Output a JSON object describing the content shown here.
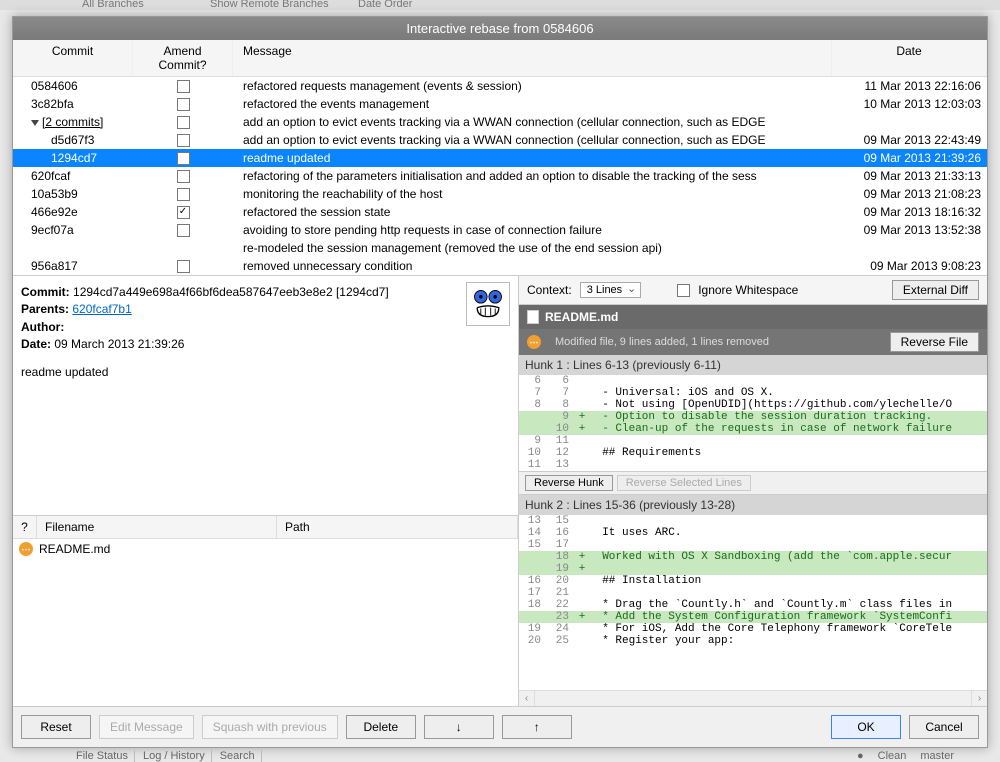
{
  "backdrop": {
    "branches": "All Branches",
    "show_remote": "Show Remote Branches",
    "date_order": "Date Order"
  },
  "dialog": {
    "title": "Interactive rebase from 0584606"
  },
  "columns": {
    "commit": "Commit",
    "amend": "Amend Commit?",
    "message": "Message",
    "date": "Date"
  },
  "rows": [
    {
      "sha": "0584606",
      "indent": false,
      "amend": false,
      "msg": "refactored requests management (events & session)",
      "date": "11 Mar 2013 22:16:06",
      "group": false
    },
    {
      "sha": "3c82bfa",
      "indent": false,
      "amend": false,
      "msg": "refactored the events management",
      "date": "10 Mar 2013 12:03:03",
      "group": false
    },
    {
      "sha": "[2 commits]",
      "indent": false,
      "amend": false,
      "msg": "add an option to evict events tracking via a WWAN connection (cellular connection, such as EDGE",
      "date": "",
      "group": true
    },
    {
      "sha": "d5d67f3",
      "indent": true,
      "amend": false,
      "msg": "add an option to evict events tracking via a WWAN connection (cellular connection, such as EDGE",
      "date": "09 Mar 2013 22:43:49",
      "group": false
    },
    {
      "sha": "1294cd7",
      "indent": true,
      "amend": false,
      "msg": "readme updated",
      "date": "09 Mar 2013 21:39:26",
      "group": false,
      "selected": true
    },
    {
      "sha": "620fcaf",
      "indent": false,
      "amend": false,
      "msg": "refactoring of the parameters initialisation and added an option to disable the tracking of the sess",
      "date": "09 Mar 2013 21:33:13",
      "group": false
    },
    {
      "sha": "10a53b9",
      "indent": false,
      "amend": false,
      "msg": "monitoring the reachability of the host",
      "date": "09 Mar 2013 21:08:23",
      "group": false
    },
    {
      "sha": "466e92e",
      "indent": false,
      "amend": true,
      "msg": "refactored the session state",
      "date": "09 Mar 2013 18:16:32",
      "group": false
    },
    {
      "sha": "9ecf07a",
      "indent": false,
      "amend": false,
      "msg": "avoiding to store pending http requests in case of connection failure",
      "date": "09 Mar 2013 13:52:38",
      "group": false
    },
    {
      "sha": "",
      "indent": false,
      "amend": null,
      "msg": "re-modeled the session management (removed the use of the end session api)",
      "date": "",
      "group": false
    },
    {
      "sha": "956a817",
      "indent": false,
      "amend": false,
      "msg": "removed unnecessary condition",
      "date": "09 Mar 2013 9:08:23",
      "group": false
    }
  ],
  "detail": {
    "commit_label": "Commit:",
    "commit_value": "1294cd7a449e698a4f66bf6dea587647eeb3e8e2 [1294cd7]",
    "parents_label": "Parents:",
    "parents_value": "620fcaf7b1",
    "author_label": "Author:",
    "author_value": "",
    "date_label": "Date:",
    "date_value": "09 March 2013 21:39:26",
    "message": "readme updated"
  },
  "filelist": {
    "q": "?",
    "filename": "Filename",
    "path": "Path",
    "files": [
      {
        "name": "README.md",
        "path": ""
      }
    ]
  },
  "diff": {
    "context_label": "Context:",
    "context_value": "3 Lines",
    "ignore_ws": "Ignore Whitespace",
    "external": "External Diff",
    "file": "README.md",
    "file_stats": "Modified file, 9 lines added, 1 lines removed",
    "reverse_file": "Reverse File",
    "hunk1_header": "Hunk 1 : Lines 6-13 (previously 6-11)",
    "hunk2_header": "Hunk 2 : Lines 15-36 (previously 13-28)",
    "reverse_hunk": "Reverse Hunk",
    "reverse_selected": "Reverse Selected Lines",
    "hunk1_lines": [
      {
        "a": "6",
        "b": "6",
        "m": " ",
        "t": "",
        "add": false
      },
      {
        "a": "7",
        "b": "7",
        "m": " ",
        "t": "  - Universal: iOS and OS X.",
        "add": false
      },
      {
        "a": "8",
        "b": "8",
        "m": " ",
        "t": "  - Not using [OpenUDID](https://github.com/ylechelle/O",
        "add": false
      },
      {
        "a": "",
        "b": "9",
        "m": "+",
        "t": "  - Option to disable the session duration tracking.",
        "add": true
      },
      {
        "a": "",
        "b": "10",
        "m": "+",
        "t": "  - Clean-up of the requests in case of network failure",
        "add": true
      },
      {
        "a": "9",
        "b": "11",
        "m": " ",
        "t": "",
        "add": false
      },
      {
        "a": "10",
        "b": "12",
        "m": " ",
        "t": "  ## Requirements",
        "add": false
      },
      {
        "a": "11",
        "b": "13",
        "m": " ",
        "t": "",
        "add": false
      }
    ],
    "hunk2_lines": [
      {
        "a": "13",
        "b": "15",
        "m": " ",
        "t": "",
        "add": false
      },
      {
        "a": "14",
        "b": "16",
        "m": " ",
        "t": "  It uses ARC.",
        "add": false
      },
      {
        "a": "15",
        "b": "17",
        "m": " ",
        "t": "",
        "add": false
      },
      {
        "a": "",
        "b": "18",
        "m": "+",
        "t": "  Worked with OS X Sandboxing (add the `com.apple.secur",
        "add": true
      },
      {
        "a": "",
        "b": "19",
        "m": "+",
        "t": "",
        "add": true
      },
      {
        "a": "16",
        "b": "20",
        "m": " ",
        "t": "  ## Installation",
        "add": false
      },
      {
        "a": "17",
        "b": "21",
        "m": " ",
        "t": "",
        "add": false
      },
      {
        "a": "18",
        "b": "22",
        "m": " ",
        "t": "  * Drag the `Countly.h` and `Countly.m` class files in",
        "add": false
      },
      {
        "a": "",
        "b": "23",
        "m": "+",
        "t": "  * Add the System Configuration framework `SystemConfi",
        "add": true
      },
      {
        "a": "19",
        "b": "24",
        "m": " ",
        "t": "  * For iOS, Add the Core Telephony framework `CoreTele",
        "add": false
      },
      {
        "a": "20",
        "b": "25",
        "m": " ",
        "t": "  * Register your app:",
        "add": false
      }
    ]
  },
  "buttons": {
    "reset": "Reset",
    "edit": "Edit Message",
    "squash": "Squash with previous",
    "delete": "Delete",
    "down": "↓",
    "up": "↑",
    "ok": "OK",
    "cancel": "Cancel"
  },
  "statusbar": {
    "file_status": "File Status",
    "log": "Log / History",
    "search": "Search",
    "clean": "Clean",
    "master": "master"
  }
}
